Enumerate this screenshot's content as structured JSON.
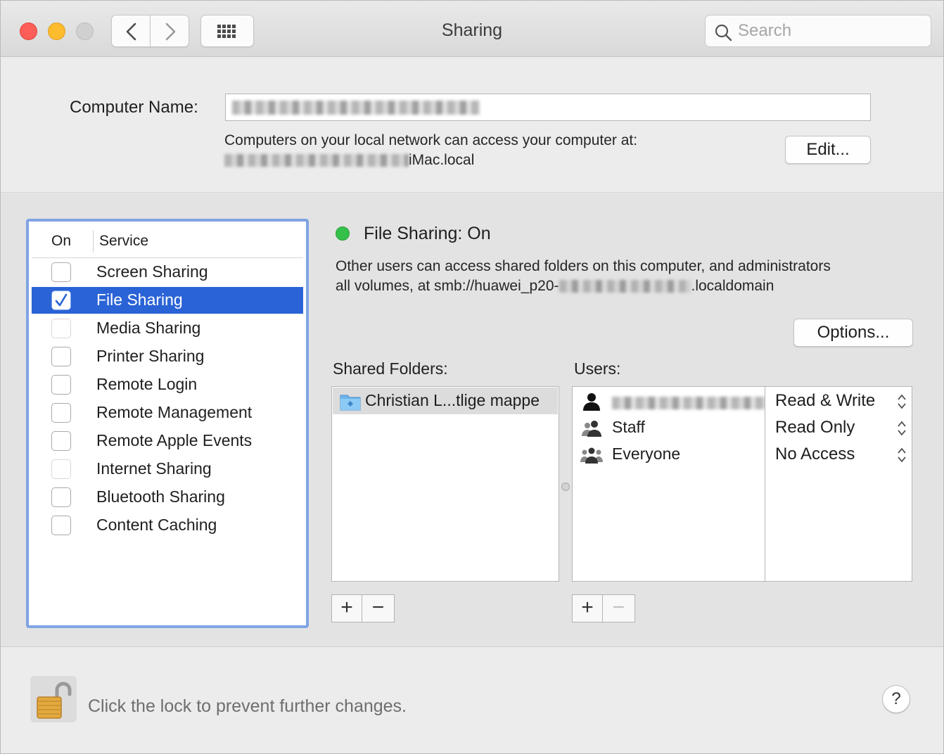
{
  "window": {
    "title": "Sharing",
    "search_placeholder": "Search"
  },
  "computer_name": {
    "label": "Computer Name:",
    "info_line1": "Computers on your local network can access your computer at:",
    "info_line2_suffix": "iMac.local",
    "edit_button": "Edit..."
  },
  "services": {
    "header_on": "On",
    "header_service": "Service",
    "items": [
      {
        "label": "Screen Sharing",
        "checked": false,
        "selected": false
      },
      {
        "label": "File Sharing",
        "checked": true,
        "selected": true
      },
      {
        "label": "Media Sharing",
        "checked": false,
        "selected": false
      },
      {
        "label": "Printer Sharing",
        "checked": false,
        "selected": false
      },
      {
        "label": "Remote Login",
        "checked": false,
        "selected": false
      },
      {
        "label": "Remote Management",
        "checked": false,
        "selected": false
      },
      {
        "label": "Remote Apple Events",
        "checked": false,
        "selected": false
      },
      {
        "label": "Internet Sharing",
        "checked": false,
        "selected": false
      },
      {
        "label": "Bluetooth Sharing",
        "checked": false,
        "selected": false
      },
      {
        "label": "Content Caching",
        "checked": false,
        "selected": false
      }
    ]
  },
  "detail": {
    "status": "File Sharing: On",
    "status_color": "#35c04a",
    "description_line1": "Other users can access shared folders on this computer, and administrators",
    "description_line2_prefix": "all volumes, at smb://huawei_p20-",
    "description_line2_suffix": ".localdomain",
    "options_button": "Options...",
    "shared_folders_label": "Shared Folders:",
    "shared_folders": [
      "Christian L...tlige mappe"
    ],
    "users_label": "Users:",
    "users": [
      {
        "name": "",
        "icon": "person-icon",
        "permission": "Read & Write"
      },
      {
        "name": "Staff",
        "icon": "group-icon",
        "permission": "Read Only"
      },
      {
        "name": "Everyone",
        "icon": "everyone-icon",
        "permission": "No Access"
      }
    ],
    "add_label": "+",
    "remove_label": "−"
  },
  "footer": {
    "lock_text": "Click the lock to prevent further changes.",
    "help_label": "?"
  },
  "colors": {
    "selection": "#2a63d6",
    "focus_ring": "#7fa4e4"
  }
}
